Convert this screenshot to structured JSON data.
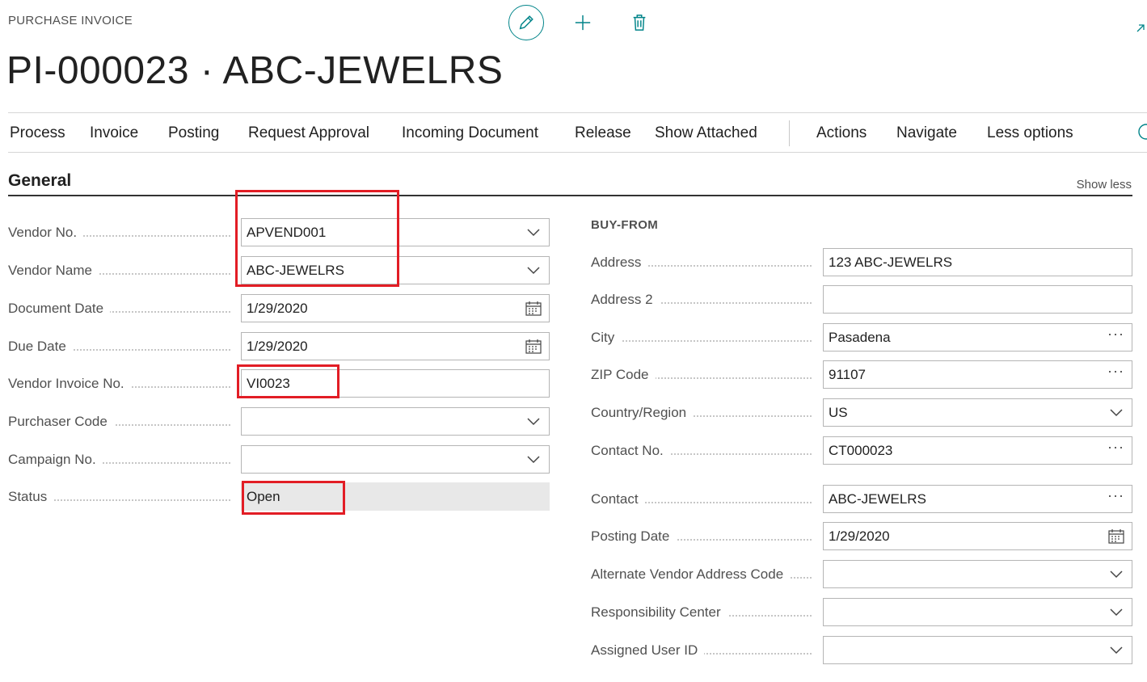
{
  "header": {
    "page_type": "PURCHASE INVOICE",
    "title": "PI-000023 · ABC-JEWELRS"
  },
  "actions": {
    "items": [
      "Process",
      "Invoice",
      "Posting",
      "Request Approval",
      "Incoming Document",
      "Release",
      "Show Attached",
      "Actions",
      "Navigate",
      "Less options"
    ]
  },
  "group": {
    "title": "General",
    "show_less": "Show less"
  },
  "left_fields": [
    {
      "label": "Vendor No.",
      "value": "APVEND001",
      "type": "dropdown"
    },
    {
      "label": "Vendor Name",
      "value": "ABC-JEWELRS",
      "type": "dropdown"
    },
    {
      "label": "Document Date",
      "value": "1/29/2020",
      "type": "date"
    },
    {
      "label": "Due Date",
      "value": "1/29/2020",
      "type": "date"
    },
    {
      "label": "Vendor Invoice No.",
      "value": "VI0023",
      "type": "text"
    },
    {
      "label": "Purchaser Code",
      "value": "",
      "type": "dropdown"
    },
    {
      "label": "Campaign No.",
      "value": "",
      "type": "dropdown"
    },
    {
      "label": "Status",
      "value": "Open",
      "type": "readonly"
    }
  ],
  "buy_from": {
    "caption": "BUY-FROM",
    "fields": [
      {
        "label": "Address",
        "value": "123 ABC-JEWELRS",
        "type": "text"
      },
      {
        "label": "Address 2",
        "value": "",
        "type": "text"
      },
      {
        "label": "City",
        "value": "Pasadena",
        "type": "lookup"
      },
      {
        "label": "ZIP Code",
        "value": "91107",
        "type": "lookup"
      },
      {
        "label": "Country/Region",
        "value": "US",
        "type": "dropdown"
      },
      {
        "label": "Contact No.",
        "value": "CT000023",
        "type": "lookup"
      },
      {
        "label": "Contact",
        "value": "ABC-JEWELRS",
        "type": "lookup"
      },
      {
        "label": "Posting Date",
        "value": "1/29/2020",
        "type": "date"
      },
      {
        "label": "Alternate Vendor Address Code",
        "value": "",
        "type": "dropdown"
      },
      {
        "label": "Responsibility Center",
        "value": "",
        "type": "dropdown"
      },
      {
        "label": "Assigned User ID",
        "value": "",
        "type": "dropdown"
      }
    ]
  },
  "icons": {
    "edit": "pencil-icon",
    "new": "plus-icon",
    "delete": "trash-icon",
    "expand": "expand-arrow-icon",
    "info": "info-icon",
    "dropdown": "chevron-down-icon",
    "date": "calendar-icon",
    "lookup": "ellipsis-icon"
  },
  "colors": {
    "accent": "#008489",
    "highlight": "#e21d25",
    "readonly_bg": "#e8e8e8"
  }
}
